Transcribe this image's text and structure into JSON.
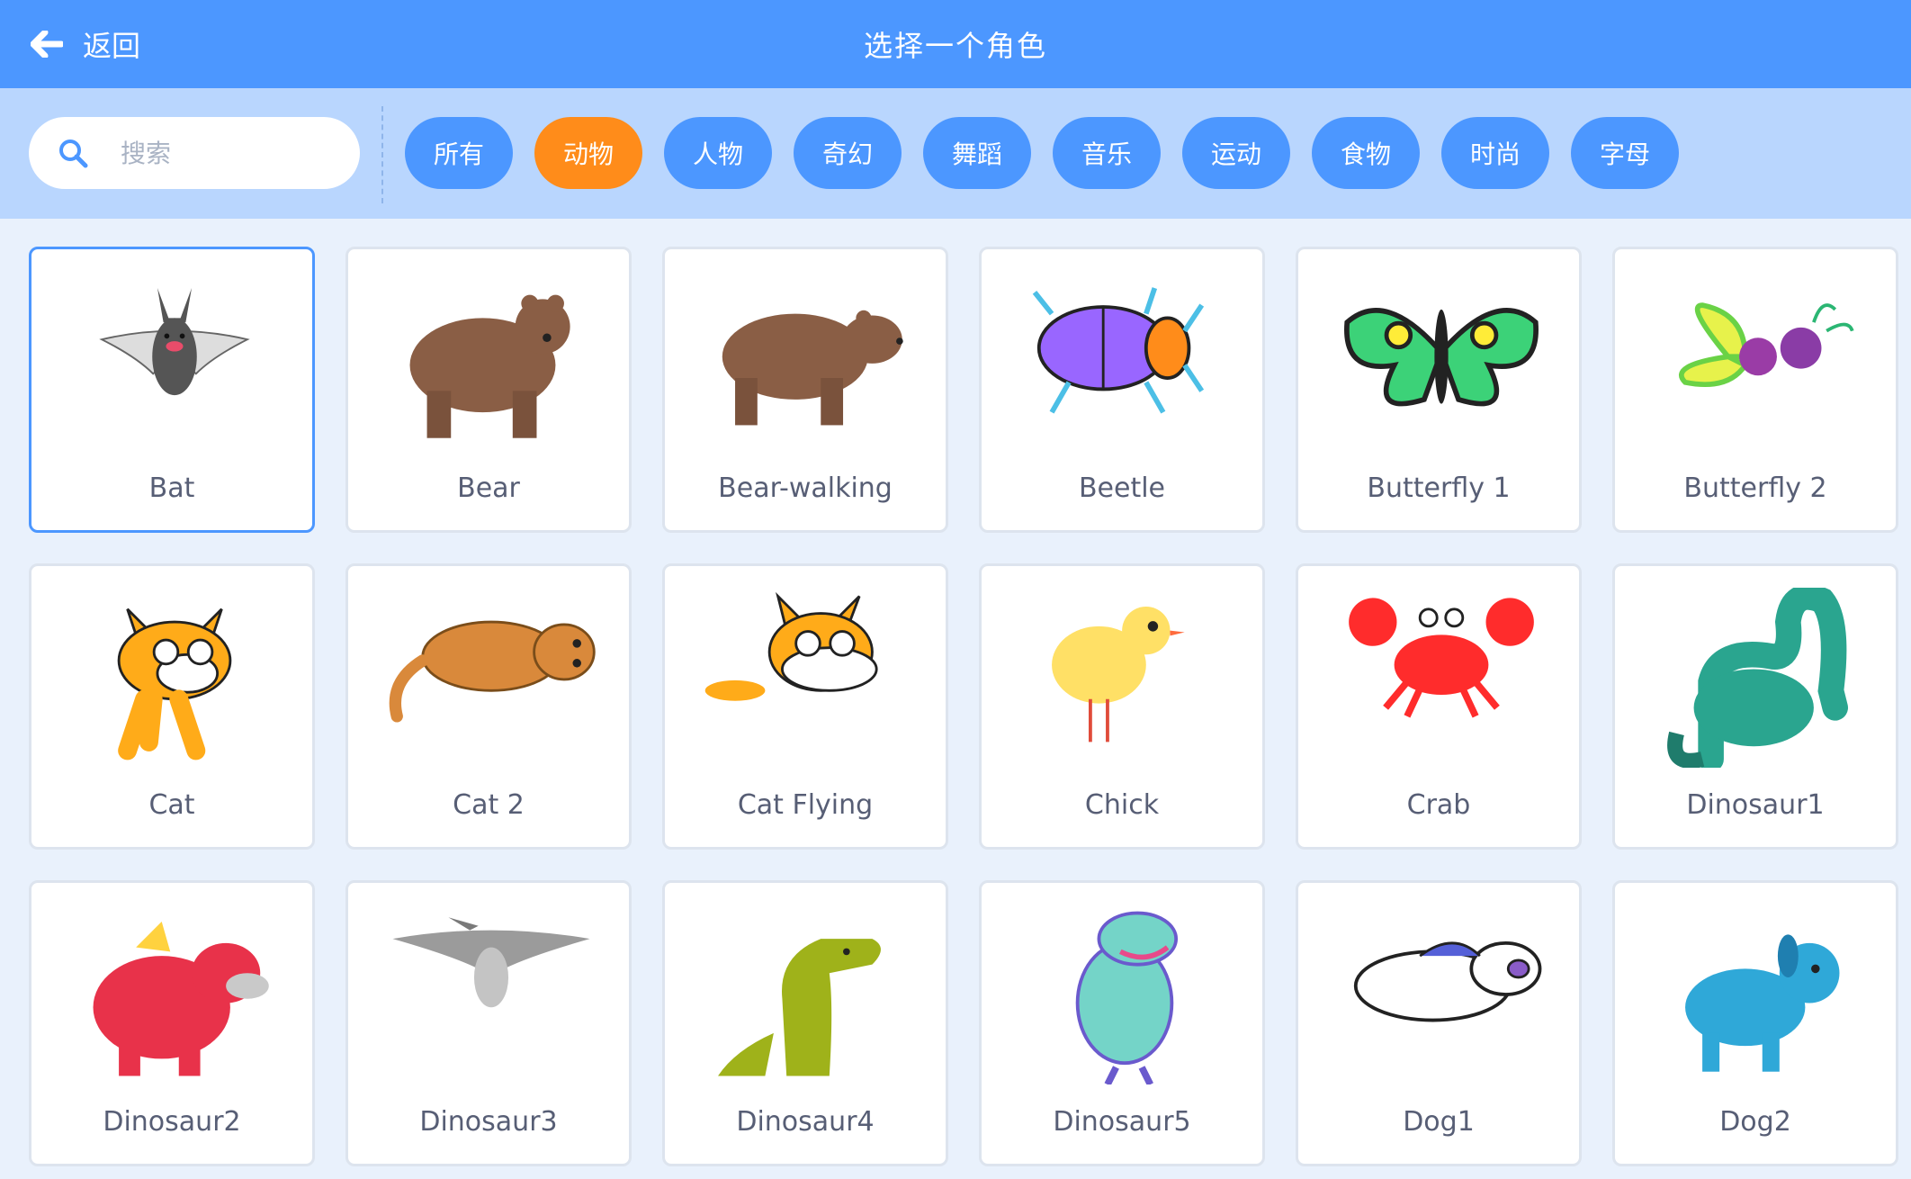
{
  "header": {
    "back_label": "返回",
    "title": "选择一个角色"
  },
  "search": {
    "placeholder": "搜索",
    "value": ""
  },
  "tags": [
    "所有",
    "动物",
    "人物",
    "奇幻",
    "舞蹈",
    "音乐",
    "运动",
    "食物",
    "时尚",
    "字母"
  ],
  "active_tag": "动物",
  "sprites": [
    {
      "name": "Bat",
      "icon": "bat-icon"
    },
    {
      "name": "Bear",
      "icon": "bear-icon"
    },
    {
      "name": "Bear-walking",
      "icon": "bear-walking-icon"
    },
    {
      "name": "Beetle",
      "icon": "beetle-icon"
    },
    {
      "name": "Butterfly 1",
      "icon": "butterfly1-icon"
    },
    {
      "name": "Butterfly 2",
      "icon": "butterfly2-icon"
    },
    {
      "name": "Cat",
      "icon": "cat-icon"
    },
    {
      "name": "Cat 2",
      "icon": "cat2-icon"
    },
    {
      "name": "Cat Flying",
      "icon": "cat-flying-icon"
    },
    {
      "name": "Chick",
      "icon": "chick-icon"
    },
    {
      "name": "Crab",
      "icon": "crab-icon"
    },
    {
      "name": "Dinosaur1",
      "icon": "dinosaur1-icon"
    },
    {
      "name": "Dinosaur2",
      "icon": "dinosaur2-icon"
    },
    {
      "name": "Dinosaur3",
      "icon": "dinosaur3-icon"
    },
    {
      "name": "Dinosaur4",
      "icon": "dinosaur4-icon"
    },
    {
      "name": "Dinosaur5",
      "icon": "dinosaur5-icon"
    },
    {
      "name": "Dog1",
      "icon": "dog1-icon"
    },
    {
      "name": "Dog2",
      "icon": "dog2-icon"
    }
  ],
  "selected_sprite": "Bat",
  "colors": {
    "header": "#4c97ff",
    "filterbar": "#b9d6fe",
    "tag": "#4c97ff",
    "active_tag": "#ff8c1a",
    "selected_border": "#4c97ff"
  }
}
